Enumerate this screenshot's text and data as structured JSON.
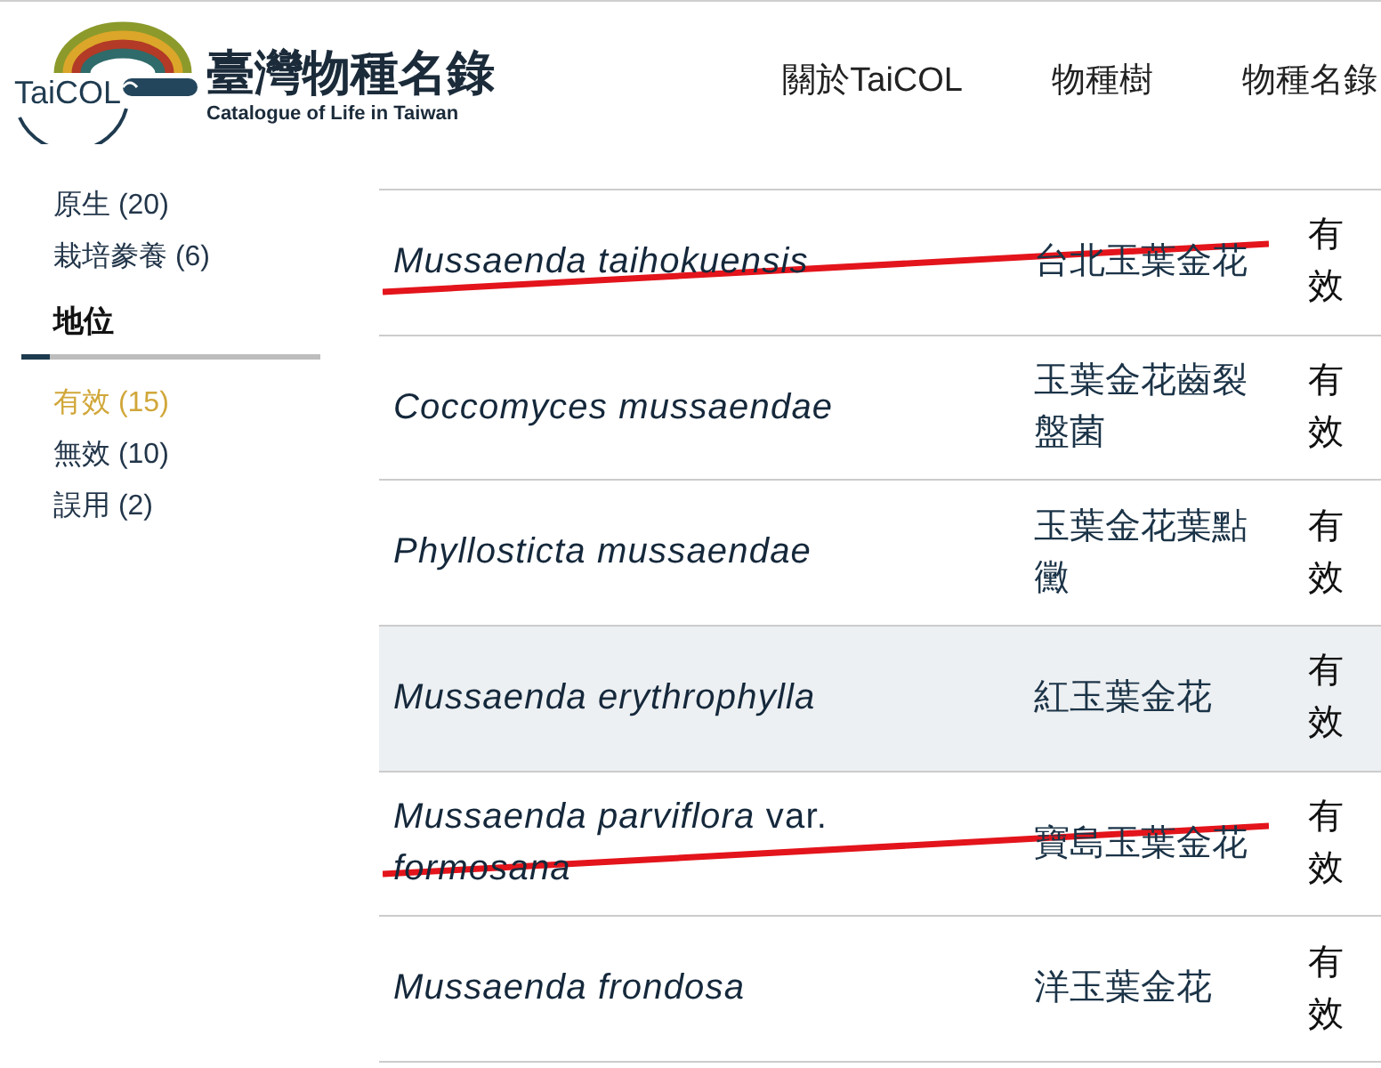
{
  "header": {
    "logo": {
      "mark_text": "TaiCOL",
      "title": "臺灣物種名錄",
      "subtitle": "Catalogue of Life in Taiwan"
    },
    "nav": [
      "關於TaiCOL",
      "物種樹",
      "物種名錄"
    ]
  },
  "sidebar": {
    "groups": [
      {
        "items": [
          {
            "label": "原生 (20)",
            "selected": false
          },
          {
            "label": "栽培豢養 (6)",
            "selected": false
          }
        ]
      },
      {
        "title": "地位",
        "items": [
          {
            "label": "有效 (15)",
            "selected": true
          },
          {
            "label": "無效 (10)",
            "selected": false
          },
          {
            "label": "誤用 (2)",
            "selected": false
          }
        ]
      }
    ]
  },
  "table": {
    "rows": [
      {
        "kind": "species",
        "scientific_name": "Mussaenda taihokuensis",
        "common_name": "台北玉葉金花",
        "status": "有效",
        "struck": true,
        "highlighted": false
      },
      {
        "kind": "species",
        "scientific_name": "Coccomyces mussaendae",
        "common_name": "玉葉金花齒裂盤菌",
        "status": "有效",
        "struck": false,
        "highlighted": false
      },
      {
        "kind": "species",
        "scientific_name": "Phyllosticta mussaendae",
        "common_name": "玉葉金花葉點黴",
        "status": "有效",
        "struck": false,
        "highlighted": false
      },
      {
        "kind": "species",
        "scientific_name": "Mussaenda erythrophylla",
        "common_name": "紅玉葉金花",
        "status": "有效",
        "struck": false,
        "highlighted": true
      },
      {
        "kind": "infraspecific",
        "scientific_name": "*Mussaenda parviflora* var. *formosana*",
        "common_name": "寶島玉葉金花",
        "status": "有效",
        "struck": true,
        "highlighted": false
      },
      {
        "kind": "species",
        "scientific_name": "Mussaenda frondosa",
        "common_name": "洋玉葉金花",
        "status": "有效",
        "struck": false,
        "highlighted": false
      }
    ]
  }
}
